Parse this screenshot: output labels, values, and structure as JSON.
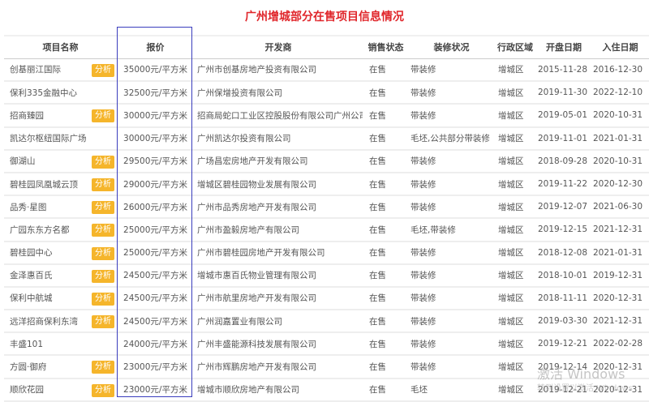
{
  "title": "广州增城部分在售项目信息情况",
  "columns": [
    "项目名称",
    "报价",
    "开发商",
    "销售状态",
    "装修状况",
    "行政区域",
    "开盘日期",
    "入住日期"
  ],
  "badge_label": "分析",
  "rows": [
    {
      "name": "创基丽江国际",
      "badge": true,
      "price": "35000元/平方米",
      "developer": "广州市创基房地产投资有限公司",
      "status": "在售",
      "decoration": "带装修",
      "region": "增城区",
      "open": "2015-11-28",
      "movein": "2016-12-30"
    },
    {
      "name": "保利335金融中心",
      "badge": false,
      "price": "32500元/平方米",
      "developer": "广州保增投资有限公司",
      "status": "在售",
      "decoration": "带装修",
      "region": "增城区",
      "open": "2019-11-30",
      "movein": "2022-12-10"
    },
    {
      "name": "招商臻园",
      "badge": true,
      "price": "30000元/平方米",
      "developer": "招商局蛇口工业区控股股份有限公司广州公司",
      "status": "在售",
      "decoration": "带装修",
      "region": "增城区",
      "open": "2019-05-01",
      "movein": "2020-10-31"
    },
    {
      "name": "凯达尔枢纽国际广场",
      "badge": false,
      "price": "30000元/平方米",
      "developer": "广州凯达尔投资有限公司",
      "status": "在售",
      "decoration": "毛坯,公共部分带装修",
      "region": "增城区",
      "open": "2019-11-01",
      "movein": "2021-01-31"
    },
    {
      "name": "御湖山",
      "badge": true,
      "price": "29500元/平方米",
      "developer": "广场昌宏房地产开发有限公司",
      "status": "在售",
      "decoration": "带装修",
      "region": "增城区",
      "open": "2018-09-28",
      "movein": "2020-10-31"
    },
    {
      "name": "碧桂园凤凰城云顶",
      "badge": true,
      "price": "29000元/平方米",
      "developer": "增城区碧桂园物业发展有限公司",
      "status": "在售",
      "decoration": "带装修",
      "region": "增城区",
      "open": "2019-11-22",
      "movein": "2020-12-30"
    },
    {
      "name": "品秀·星图",
      "badge": true,
      "price": "26000元/平方米",
      "developer": "广州市品秀房地产开发有限公司",
      "status": "在售",
      "decoration": "带装修",
      "region": "增城区",
      "open": "2019-12-07",
      "movein": "2021-06-30"
    },
    {
      "name": "广园东东方名都",
      "badge": true,
      "price": "25000元/平方米",
      "developer": "广州市盈毅房地产有限公司",
      "status": "在售",
      "decoration": "毛坯,带装修",
      "region": "增城区",
      "open": "2019-12-15",
      "movein": "2021-12-31"
    },
    {
      "name": "碧桂园中心",
      "badge": true,
      "price": "25000元/平方米",
      "developer": "广州市碧桂园房地产开发有限公司",
      "status": "在售",
      "decoration": "带装修",
      "region": "增城区",
      "open": "2018-12-08",
      "movein": "2021-01-31"
    },
    {
      "name": "金泽惠百氏",
      "badge": true,
      "price": "24500元/平方米",
      "developer": "增城市惠百氏物业管理有限公司",
      "status": "在售",
      "decoration": "带装修",
      "region": "增城区",
      "open": "2018-10-01",
      "movein": "2019-12-31"
    },
    {
      "name": "保利中航城",
      "badge": true,
      "price": "24500元/平方米",
      "developer": "广州市航里房地产开发有限公司",
      "status": "在售",
      "decoration": "带装修",
      "region": "增城区",
      "open": "2018-11-11",
      "movein": "2020-12-31"
    },
    {
      "name": "远洋招商保利东湾",
      "badge": true,
      "price": "24500元/平方米",
      "developer": "广州润嘉置业有限公司",
      "status": "在售",
      "decoration": "带装修",
      "region": "增城区",
      "open": "2019-03-30",
      "movein": "2021-12-31"
    },
    {
      "name": "丰盛101",
      "badge": false,
      "price": "24000元/平方米",
      "developer": "广州丰盛能源科技发展有限公司",
      "status": "在售",
      "decoration": "带装修",
      "region": "增城区",
      "open": "2019-12-21",
      "movein": "2022-02-28"
    },
    {
      "name": "方圆·御府",
      "badge": true,
      "price": "23000元/平方米",
      "developer": "广州市辉鹏房地产开发有限公司",
      "status": "在售",
      "decoration": "带装修",
      "region": "增城区",
      "open": "2019-12-14",
      "movein": "2020-12-31"
    },
    {
      "name": "顺欣花园",
      "badge": true,
      "price": "23000元/平方米",
      "developer": "增城市顺欣房地产有限公司",
      "status": "在售",
      "decoration": "毛坯",
      "region": "增城区",
      "open": "2019-12-21",
      "movein": "2020-12-31"
    }
  ],
  "watermark": {
    "line1": "激活 Windows",
    "line2": "转到设置以激活 Windows"
  },
  "colors": {
    "title": "#e0262b",
    "badge": "#f5b52b",
    "highlight": "#3a3dbd"
  }
}
